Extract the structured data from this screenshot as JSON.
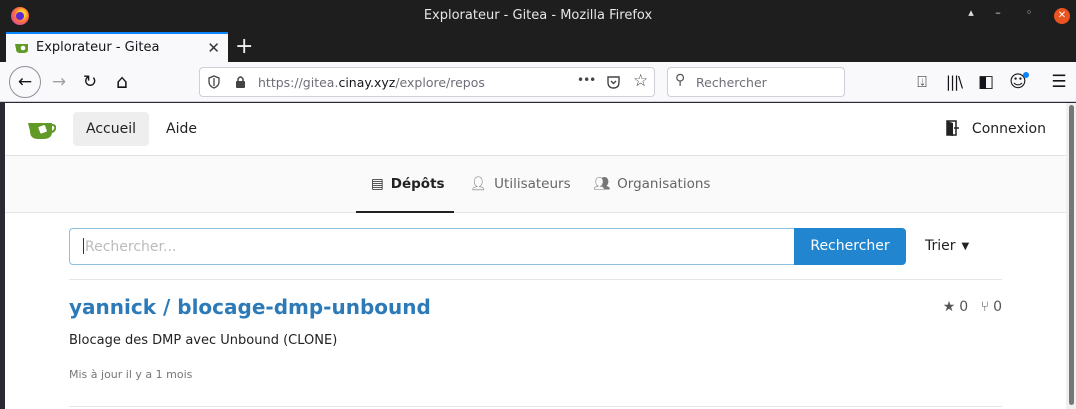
{
  "window": {
    "title": "Explorateur - Gitea - Mozilla Firefox",
    "controls": [
      "▴",
      "–",
      "◦",
      "✕"
    ]
  },
  "tabs": [
    {
      "label": "Explorateur - Gitea",
      "close": "✕"
    }
  ],
  "newtab_label": "+",
  "navbar": {
    "back": "←",
    "forward": "→",
    "reload": "↻",
    "home": "⌂",
    "url_prefix": "https://gitea.",
    "url_domain": "cinay.xyz",
    "url_path": "/explore/repos",
    "page_actions": "•••",
    "search_placeholder": "Rechercher"
  },
  "site": {
    "nav": {
      "home": "Accueil",
      "help": "Aide",
      "signin": "Connexion"
    },
    "tabs": [
      {
        "label": "Dépôts"
      },
      {
        "label": "Utilisateurs"
      },
      {
        "label": "Organisations"
      }
    ],
    "search": {
      "placeholder": "Rechercher...",
      "button": "Rechercher"
    },
    "sort": "Trier"
  },
  "repos": [
    {
      "name": "yannick / blocage-dmp-unbound",
      "description": "Blocage des DMP avec Unbound (CLONE)",
      "updated": "Mis à jour il y a 1 mois",
      "stars": "0",
      "forks": "0"
    }
  ],
  "colors": {
    "accent": "#2185d0",
    "link": "#2c7ab8",
    "gitea_green": "#609926"
  }
}
